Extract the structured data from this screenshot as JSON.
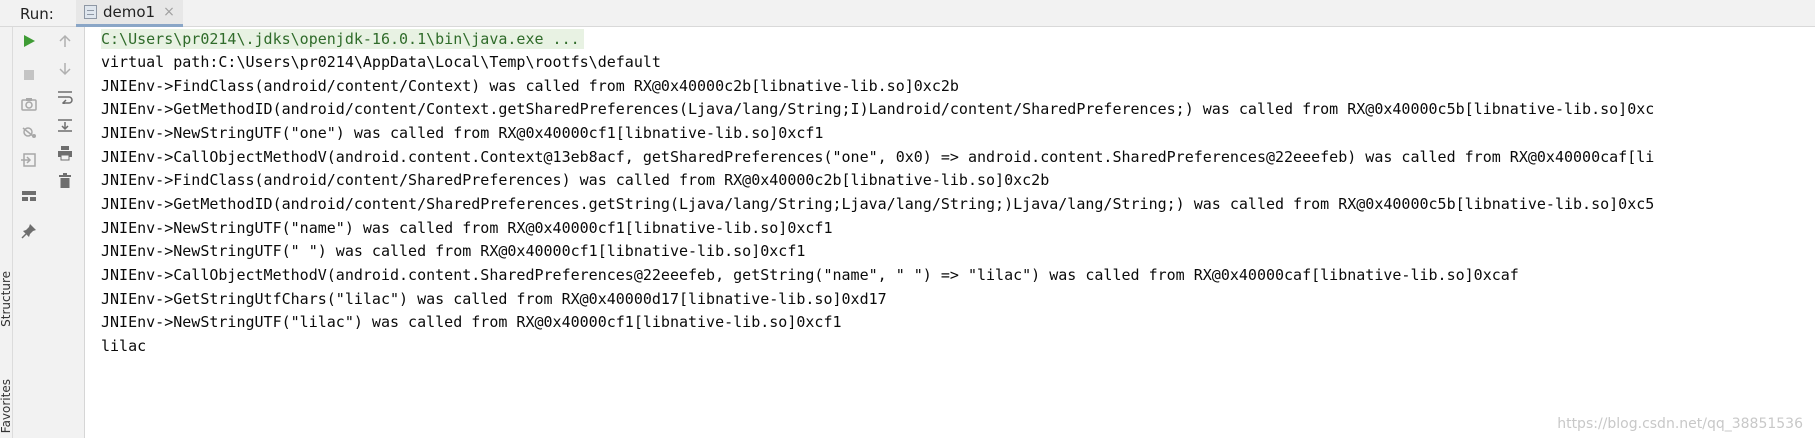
{
  "header": {
    "run_label": "Run:",
    "tab_title": "demo1",
    "tab_close": "×"
  },
  "left_stripe": {
    "structure_label": "Structure",
    "favorites_label": "Favorites"
  },
  "toolbar": {
    "col1": [
      "run-icon",
      "stop-icon",
      "camera-icon",
      "debug-settings-icon",
      "exit-icon",
      "layout-icon",
      "pin-icon"
    ],
    "col2": [
      "up-arrow-icon",
      "down-arrow-icon",
      "soft-wrap-icon",
      "scroll-to-end-icon",
      "print-icon",
      "trash-icon"
    ]
  },
  "console": {
    "lines": [
      "C:\\Users\\pr0214\\.jdks\\openjdk-16.0.1\\bin\\java.exe ...",
      "virtual path:C:\\Users\\pr0214\\AppData\\Local\\Temp\\rootfs\\default",
      "JNIEnv->FindClass(android/content/Context) was called from RX@0x40000c2b[libnative-lib.so]0xc2b",
      "JNIEnv->GetMethodID(android/content/Context.getSharedPreferences(Ljava/lang/String;I)Landroid/content/SharedPreferences;) was called from RX@0x40000c5b[libnative-lib.so]0xc",
      "JNIEnv->NewStringUTF(\"one\") was called from RX@0x40000cf1[libnative-lib.so]0xcf1",
      "JNIEnv->CallObjectMethodV(android.content.Context@13eb8acf, getSharedPreferences(\"one\", 0x0) => android.content.SharedPreferences@22eeefeb) was called from RX@0x40000caf[li",
      "JNIEnv->FindClass(android/content/SharedPreferences) was called from RX@0x40000c2b[libnative-lib.so]0xc2b",
      "JNIEnv->GetMethodID(android/content/SharedPreferences.getString(Ljava/lang/String;Ljava/lang/String;)Ljava/lang/String;) was called from RX@0x40000c5b[libnative-lib.so]0xc5",
      "JNIEnv->NewStringUTF(\"name\") was called from RX@0x40000cf1[libnative-lib.so]0xcf1",
      "JNIEnv->NewStringUTF(\" \") was called from RX@0x40000cf1[libnative-lib.so]0xcf1",
      "JNIEnv->CallObjectMethodV(android.content.SharedPreferences@22eeefeb, getString(\"name\", \" \") => \"lilac\") was called from RX@0x40000caf[libnative-lib.so]0xcaf",
      "JNIEnv->GetStringUtfChars(\"lilac\") was called from RX@0x40000d17[libnative-lib.so]0xd17",
      "JNIEnv->NewStringUTF(\"lilac\") was called from RX@0x40000cf1[libnative-lib.so]0xcf1",
      "lilac"
    ],
    "watermark": "https://blog.csdn.net/qq_38851536"
  },
  "colors": {
    "run_green": "#3f9c35",
    "command_text": "#2f6b2a",
    "command_bg": "#e8f2e3",
    "toolbar_bg": "#f2f2f2",
    "icon_gray": "#8c8c8c"
  }
}
